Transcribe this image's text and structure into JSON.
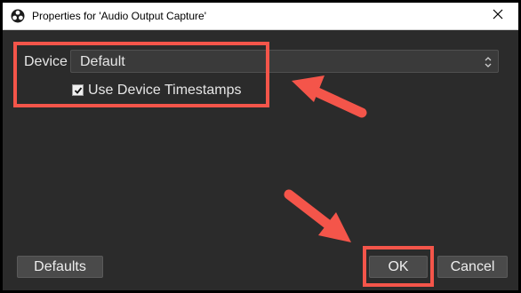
{
  "window": {
    "title": "Properties for 'Audio Output Capture'",
    "app_icon": "obs-logo-icon",
    "close_icon": "close-icon"
  },
  "form": {
    "device_label": "Device",
    "device_value": "Default",
    "device_select_icon": "chevron-up-down-icon",
    "timestamps_label": "Use Device Timestamps",
    "timestamps_checked": true
  },
  "buttons": {
    "defaults": "Defaults",
    "ok": "OK",
    "cancel": "Cancel"
  },
  "annotations": {
    "highlight_color": "#f4554a",
    "arrow_color": "#f4554a"
  },
  "colors": {
    "dialog_background": "#2b2b2b",
    "titlebar_background": "#ffffff",
    "text": "#e6e6e6"
  }
}
